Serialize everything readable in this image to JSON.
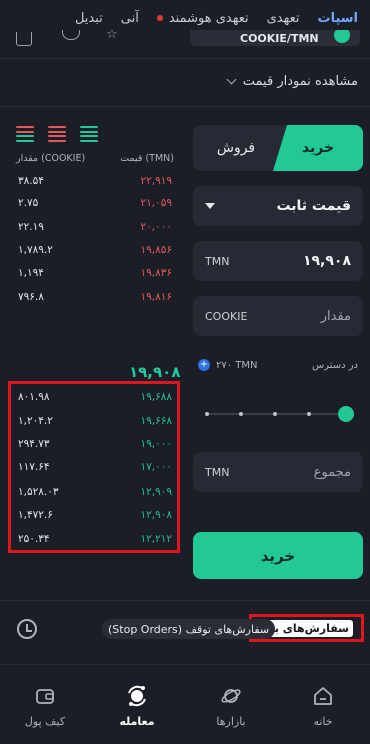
{
  "top_tabs": [
    {
      "label": "اسپات",
      "active": true
    },
    {
      "label": "تعهدی",
      "active": false
    },
    {
      "label": "تعهدی هوشمند",
      "active": false,
      "indicator": "red-dot"
    },
    {
      "label": "آنی",
      "active": false
    },
    {
      "label": "تبدیل",
      "active": false
    }
  ],
  "market": {
    "name": "COOKIE",
    "quote": "TMN"
  },
  "chart_link": "مشاهده نمودار قیمت",
  "order_book": {
    "header_price": "قیمت (TMN)",
    "header_amount": "مقدار (COOKIE)",
    "sells": [
      {
        "price": "۲۲,۹۱۹",
        "amount": "۳۸.۵۴"
      },
      {
        "price": "۲۱,۰۵۹",
        "amount": "۲.۷۵"
      },
      {
        "price": "۲۰,۰۰۰",
        "amount": "۲۲.۱۹"
      },
      {
        "price": "۱۹,۸۵۶",
        "amount": "۱,۷۸۹.۲"
      },
      {
        "price": "۱۹,۸۳۶",
        "amount": "۱,۱۹۴"
      },
      {
        "price": "۱۹,۸۱۶",
        "amount": "۷۹۶.۸"
      }
    ],
    "last_price": "۱۹,۹۰۸",
    "buys": [
      {
        "price": "۱۹,۶۸۸",
        "amount": "۸۰۱.۹۸"
      },
      {
        "price": "۱۹,۶۶۸",
        "amount": "۱,۲۰۴.۲"
      },
      {
        "price": "۱۹,۰۰۰",
        "amount": "۲۹۴.۷۳"
      },
      {
        "price": "۱۷,۰۰۰",
        "amount": "۱۱۷.۶۴"
      },
      {
        "price": "۱۲,۹۰۹",
        "amount": "۱,۵۲۸.۰۳"
      },
      {
        "price": "۱۲,۹۰۸",
        "amount": "۱,۴۷۲.۶"
      },
      {
        "price": "۱۲,۲۱۲",
        "amount": "۲۵۰.۳۴"
      }
    ]
  },
  "trade_form": {
    "buy_label": "خرید",
    "sell_label": "فروش",
    "order_type": "قیمت ثابت",
    "price_unit": "TMN",
    "price_value": "۱۹,۹۰۸",
    "amount_unit": "COOKIE",
    "amount_placeholder": "مقدار",
    "available_label": "در دسترس",
    "available_value": "۲۷۰ TMN",
    "total_unit": "TMN",
    "total_placeholder": "مجموع",
    "submit_label": "خرید"
  },
  "orders_tabs": {
    "open_orders": "سفارش‌های باز",
    "stop_orders": "سفارش‌های توقف (Stop Orders)"
  },
  "bottom_nav": [
    {
      "label": "خانه",
      "icon": "home-icon",
      "active": false
    },
    {
      "label": "بازارها",
      "icon": "planet-icon",
      "active": false
    },
    {
      "label": "معامله",
      "icon": "trade-icon",
      "active": true
    },
    {
      "label": "کیف پول",
      "icon": "wallet-icon",
      "active": false
    }
  ],
  "colors": {
    "accent_green": "#22c995",
    "sell_red": "#e45a5a",
    "link_blue": "#6ea8ff",
    "highlight_red": "#e0161f"
  }
}
